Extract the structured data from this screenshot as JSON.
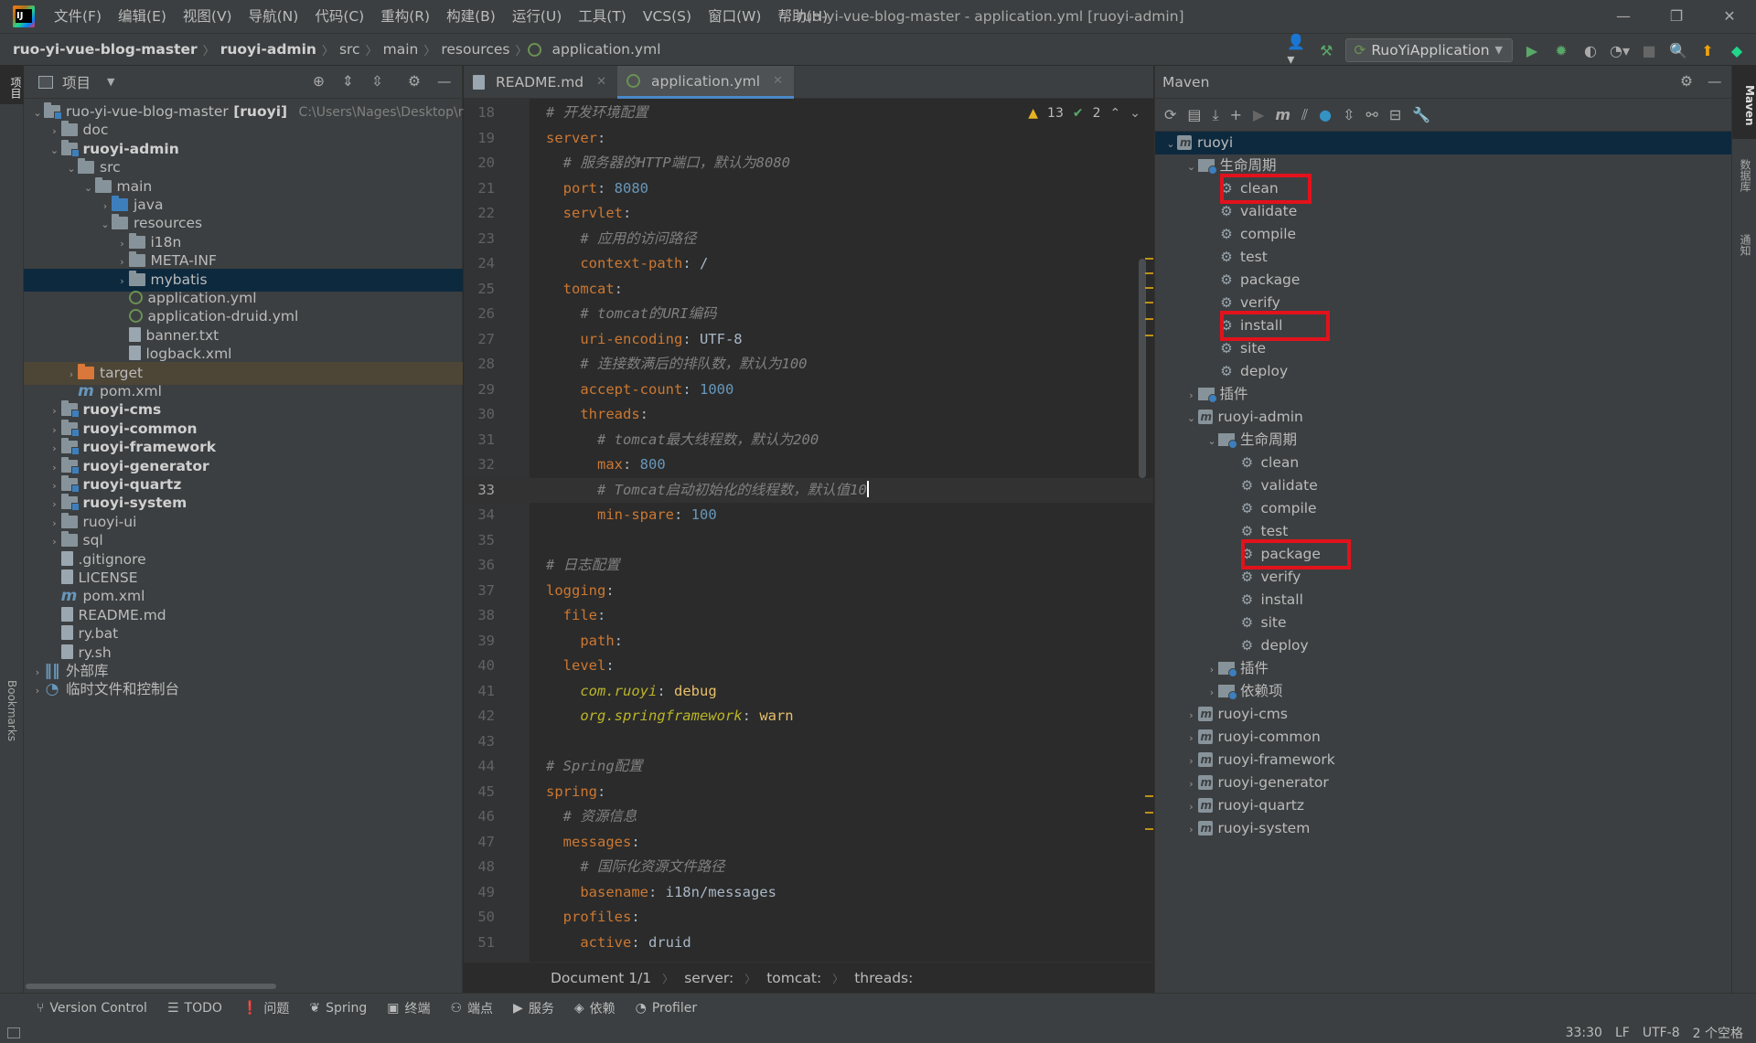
{
  "window": {
    "title": "ruo-yi-vue-blog-master - application.yml [ruoyi-admin]"
  },
  "menu": [
    "文件(F)",
    "编辑(E)",
    "视图(V)",
    "导航(N)",
    "代码(C)",
    "重构(R)",
    "构建(B)",
    "运行(U)",
    "工具(T)",
    "VCS(S)",
    "窗口(W)",
    "帮助(H)"
  ],
  "breadcrumb": [
    "ruo-yi-vue-blog-master",
    "ruoyi-admin",
    "src",
    "main",
    "resources",
    "application.yml"
  ],
  "run_config": "RuoYiApplication",
  "left_strip": {
    "project": "项目",
    "bookmarks": "Bookmarks",
    "structure": "结构"
  },
  "right_strip": {
    "maven": "Maven",
    "database": "数据库",
    "notifications": "通知"
  },
  "project": {
    "header": "项目",
    "tree": [
      {
        "label": "ruo-yi-vue-blog-master",
        "suffix": "[ruoyi]",
        "path": "C:\\Users\\Nages\\Desktop\\r",
        "icon": "module",
        "indent": 0,
        "arrow": "down"
      },
      {
        "label": "doc",
        "icon": "folder",
        "indent": 1,
        "arrow": "right"
      },
      {
        "label": "ruoyi-admin",
        "icon": "module",
        "indent": 1,
        "arrow": "down",
        "bold": true
      },
      {
        "label": "src",
        "icon": "folder",
        "indent": 2,
        "arrow": "down"
      },
      {
        "label": "main",
        "icon": "folder",
        "indent": 3,
        "arrow": "down"
      },
      {
        "label": "java",
        "icon": "folder-blue",
        "indent": 4,
        "arrow": "right"
      },
      {
        "label": "resources",
        "icon": "folder",
        "indent": 4,
        "arrow": "down"
      },
      {
        "label": "i18n",
        "icon": "folder",
        "indent": 5,
        "arrow": "right"
      },
      {
        "label": "META-INF",
        "icon": "folder",
        "indent": 5,
        "arrow": "right"
      },
      {
        "label": "mybatis",
        "icon": "folder",
        "indent": 5,
        "arrow": "right",
        "selected": true
      },
      {
        "label": "application.yml",
        "icon": "yml",
        "indent": 5,
        "arrow": ""
      },
      {
        "label": "application-druid.yml",
        "icon": "yml",
        "indent": 5,
        "arrow": ""
      },
      {
        "label": "banner.txt",
        "icon": "file",
        "indent": 5,
        "arrow": ""
      },
      {
        "label": "logback.xml",
        "icon": "file",
        "indent": 5,
        "arrow": ""
      },
      {
        "label": "target",
        "icon": "folder-orange",
        "indent": 2,
        "arrow": "right",
        "target": true
      },
      {
        "label": "pom.xml",
        "icon": "mvn",
        "indent": 2,
        "arrow": ""
      },
      {
        "label": "ruoyi-cms",
        "icon": "module",
        "indent": 1,
        "arrow": "right",
        "bold": true
      },
      {
        "label": "ruoyi-common",
        "icon": "module",
        "indent": 1,
        "arrow": "right",
        "bold": true
      },
      {
        "label": "ruoyi-framework",
        "icon": "module",
        "indent": 1,
        "arrow": "right",
        "bold": true
      },
      {
        "label": "ruoyi-generator",
        "icon": "module",
        "indent": 1,
        "arrow": "right",
        "bold": true
      },
      {
        "label": "ruoyi-quartz",
        "icon": "module",
        "indent": 1,
        "arrow": "right",
        "bold": true
      },
      {
        "label": "ruoyi-system",
        "icon": "module",
        "indent": 1,
        "arrow": "right",
        "bold": true
      },
      {
        "label": "ruoyi-ui",
        "icon": "folder",
        "indent": 1,
        "arrow": "right"
      },
      {
        "label": "sql",
        "icon": "folder",
        "indent": 1,
        "arrow": "right"
      },
      {
        "label": ".gitignore",
        "icon": "file",
        "indent": 1,
        "arrow": ""
      },
      {
        "label": "LICENSE",
        "icon": "file",
        "indent": 1,
        "arrow": ""
      },
      {
        "label": "pom.xml",
        "icon": "mvn",
        "indent": 1,
        "arrow": ""
      },
      {
        "label": "README.md",
        "icon": "file",
        "indent": 1,
        "arrow": ""
      },
      {
        "label": "ry.bat",
        "icon": "file",
        "indent": 1,
        "arrow": ""
      },
      {
        "label": "ry.sh",
        "icon": "file",
        "indent": 1,
        "arrow": ""
      },
      {
        "label": "外部库",
        "icon": "lib",
        "indent": 0,
        "arrow": "right"
      },
      {
        "label": "临时文件和控制台",
        "icon": "scratch",
        "indent": 0,
        "arrow": "right"
      }
    ]
  },
  "editor": {
    "tabs": [
      {
        "label": "README.md",
        "active": false
      },
      {
        "label": "application.yml",
        "active": true
      }
    ],
    "inspections": {
      "warnings": "13",
      "ok": "2"
    },
    "lines": [
      {
        "n": "18",
        "parts": [
          [
            "c",
            "# 开发环境配置"
          ]
        ]
      },
      {
        "n": "19",
        "parts": [
          [
            "k",
            "server"
          ],
          [
            "s",
            ":"
          ]
        ]
      },
      {
        "n": "20",
        "parts": [
          [
            "s",
            "  "
          ],
          [
            "c",
            "# 服务器的HTTP端口，默认为8080"
          ]
        ]
      },
      {
        "n": "21",
        "parts": [
          [
            "s",
            "  "
          ],
          [
            "k",
            "port"
          ],
          [
            "s",
            ": "
          ],
          [
            "v",
            "8080"
          ]
        ]
      },
      {
        "n": "22",
        "parts": [
          [
            "s",
            "  "
          ],
          [
            "k",
            "servlet"
          ],
          [
            "s",
            ":"
          ]
        ]
      },
      {
        "n": "23",
        "parts": [
          [
            "s",
            "    "
          ],
          [
            "c",
            "# 应用的访问路径"
          ]
        ]
      },
      {
        "n": "24",
        "parts": [
          [
            "s",
            "    "
          ],
          [
            "k",
            "context-path"
          ],
          [
            "s",
            ": /"
          ]
        ]
      },
      {
        "n": "25",
        "parts": [
          [
            "s",
            "  "
          ],
          [
            "k",
            "tomcat"
          ],
          [
            "s",
            ":"
          ]
        ]
      },
      {
        "n": "26",
        "parts": [
          [
            "s",
            "    "
          ],
          [
            "c",
            "# tomcat的URI编码"
          ]
        ]
      },
      {
        "n": "27",
        "parts": [
          [
            "s",
            "    "
          ],
          [
            "k",
            "uri-encoding"
          ],
          [
            "s",
            ": UTF-8"
          ]
        ]
      },
      {
        "n": "28",
        "parts": [
          [
            "s",
            "    "
          ],
          [
            "c",
            "# 连接数满后的排队数，默认为100"
          ]
        ]
      },
      {
        "n": "29",
        "parts": [
          [
            "s",
            "    "
          ],
          [
            "k",
            "accept-count"
          ],
          [
            "s",
            ": "
          ],
          [
            "v",
            "1000"
          ]
        ]
      },
      {
        "n": "30",
        "parts": [
          [
            "s",
            "    "
          ],
          [
            "k",
            "threads"
          ],
          [
            "s",
            ":"
          ]
        ]
      },
      {
        "n": "31",
        "parts": [
          [
            "s",
            "      "
          ],
          [
            "c",
            "# tomcat最大线程数，默认为200"
          ]
        ]
      },
      {
        "n": "32",
        "parts": [
          [
            "s",
            "      "
          ],
          [
            "k",
            "max"
          ],
          [
            "s",
            ": "
          ],
          [
            "v",
            "800"
          ]
        ]
      },
      {
        "n": "33",
        "parts": [
          [
            "s",
            "      "
          ],
          [
            "c",
            "# Tomcat启动初始化的线程数，默认值10"
          ]
        ],
        "current": true
      },
      {
        "n": "34",
        "parts": [
          [
            "s",
            "      "
          ],
          [
            "k",
            "min-spare"
          ],
          [
            "s",
            ": "
          ],
          [
            "v",
            "100"
          ]
        ]
      },
      {
        "n": "35",
        "parts": []
      },
      {
        "n": "36",
        "parts": [
          [
            "c",
            "# 日志配置"
          ]
        ]
      },
      {
        "n": "37",
        "parts": [
          [
            "k",
            "logging"
          ],
          [
            "s",
            ":"
          ]
        ]
      },
      {
        "n": "38",
        "parts": [
          [
            "s",
            "  "
          ],
          [
            "k",
            "file"
          ],
          [
            "s",
            ":"
          ]
        ]
      },
      {
        "n": "39",
        "parts": [
          [
            "s",
            "    "
          ],
          [
            "k",
            "path"
          ],
          [
            "s",
            ":"
          ]
        ]
      },
      {
        "n": "40",
        "parts": [
          [
            "s",
            "  "
          ],
          [
            "k",
            "level"
          ],
          [
            "s",
            ":"
          ]
        ]
      },
      {
        "n": "41",
        "parts": [
          [
            "s",
            "    "
          ],
          [
            "y",
            "com.ruoyi"
          ],
          [
            "s",
            ": "
          ],
          [
            "w",
            "debug"
          ]
        ]
      },
      {
        "n": "42",
        "parts": [
          [
            "s",
            "    "
          ],
          [
            "y",
            "org.springframework"
          ],
          [
            "s",
            ": "
          ],
          [
            "w",
            "warn"
          ]
        ]
      },
      {
        "n": "43",
        "parts": []
      },
      {
        "n": "44",
        "parts": [
          [
            "c",
            "# Spring配置"
          ]
        ]
      },
      {
        "n": "45",
        "parts": [
          [
            "k",
            "spring"
          ],
          [
            "s",
            ":"
          ]
        ]
      },
      {
        "n": "46",
        "parts": [
          [
            "s",
            "  "
          ],
          [
            "c",
            "# 资源信息"
          ]
        ]
      },
      {
        "n": "47",
        "parts": [
          [
            "s",
            "  "
          ],
          [
            "k",
            "messages"
          ],
          [
            "s",
            ":"
          ]
        ]
      },
      {
        "n": "48",
        "parts": [
          [
            "s",
            "    "
          ],
          [
            "c",
            "# 国际化资源文件路径"
          ]
        ]
      },
      {
        "n": "49",
        "parts": [
          [
            "s",
            "    "
          ],
          [
            "k",
            "basename"
          ],
          [
            "s",
            ": i18n/messages"
          ]
        ]
      },
      {
        "n": "50",
        "parts": [
          [
            "s",
            "  "
          ],
          [
            "k",
            "profiles"
          ],
          [
            "s",
            ":"
          ]
        ]
      },
      {
        "n": "51",
        "parts": [
          [
            "s",
            "    "
          ],
          [
            "k",
            "active"
          ],
          [
            "s",
            ": druid"
          ]
        ]
      }
    ],
    "breadcrumbs": [
      "Document 1/1",
      "server:",
      "tomcat:",
      "threads:"
    ]
  },
  "maven": {
    "header": "Maven",
    "tree": [
      {
        "label": "ruoyi",
        "icon": "mproj",
        "indent": 0,
        "arrow": "down",
        "selected": true
      },
      {
        "label": "生命周期",
        "icon": "lc",
        "indent": 1,
        "arrow": "down"
      },
      {
        "label": "clean",
        "icon": "gear",
        "indent": 2,
        "arrow": "",
        "highlight": true
      },
      {
        "label": "validate",
        "icon": "gear",
        "indent": 2,
        "arrow": ""
      },
      {
        "label": "compile",
        "icon": "gear",
        "indent": 2,
        "arrow": ""
      },
      {
        "label": "test",
        "icon": "gear",
        "indent": 2,
        "arrow": ""
      },
      {
        "label": "package",
        "icon": "gear",
        "indent": 2,
        "arrow": ""
      },
      {
        "label": "verify",
        "icon": "gear",
        "indent": 2,
        "arrow": ""
      },
      {
        "label": "install",
        "icon": "gear",
        "indent": 2,
        "arrow": "",
        "highlight": true
      },
      {
        "label": "site",
        "icon": "gear",
        "indent": 2,
        "arrow": ""
      },
      {
        "label": "deploy",
        "icon": "gear",
        "indent": 2,
        "arrow": ""
      },
      {
        "label": "插件",
        "icon": "lc",
        "indent": 1,
        "arrow": "right"
      },
      {
        "label": "ruoyi-admin",
        "icon": "mproj",
        "indent": 1,
        "arrow": "down"
      },
      {
        "label": "生命周期",
        "icon": "lc",
        "indent": 2,
        "arrow": "down"
      },
      {
        "label": "clean",
        "icon": "gear",
        "indent": 3,
        "arrow": ""
      },
      {
        "label": "validate",
        "icon": "gear",
        "indent": 3,
        "arrow": ""
      },
      {
        "label": "compile",
        "icon": "gear",
        "indent": 3,
        "arrow": ""
      },
      {
        "label": "test",
        "icon": "gear",
        "indent": 3,
        "arrow": ""
      },
      {
        "label": "package",
        "icon": "gear",
        "indent": 3,
        "arrow": "",
        "highlight": true
      },
      {
        "label": "verify",
        "icon": "gear",
        "indent": 3,
        "arrow": ""
      },
      {
        "label": "install",
        "icon": "gear",
        "indent": 3,
        "arrow": ""
      },
      {
        "label": "site",
        "icon": "gear",
        "indent": 3,
        "arrow": ""
      },
      {
        "label": "deploy",
        "icon": "gear",
        "indent": 3,
        "arrow": ""
      },
      {
        "label": "插件",
        "icon": "lc",
        "indent": 2,
        "arrow": "right"
      },
      {
        "label": "依赖项",
        "icon": "lc",
        "indent": 2,
        "arrow": "right"
      },
      {
        "label": "ruoyi-cms",
        "icon": "mproj",
        "indent": 1,
        "arrow": "right"
      },
      {
        "label": "ruoyi-common",
        "icon": "mproj",
        "indent": 1,
        "arrow": "right"
      },
      {
        "label": "ruoyi-framework",
        "icon": "mproj",
        "indent": 1,
        "arrow": "right"
      },
      {
        "label": "ruoyi-generator",
        "icon": "mproj",
        "indent": 1,
        "arrow": "right"
      },
      {
        "label": "ruoyi-quartz",
        "icon": "mproj",
        "indent": 1,
        "arrow": "right"
      },
      {
        "label": "ruoyi-system",
        "icon": "mproj",
        "indent": 1,
        "arrow": "right"
      }
    ]
  },
  "toolwindows": [
    {
      "label": "Version Control",
      "icon": "vcs-icon",
      "glyph": "⑂"
    },
    {
      "label": "TODO",
      "icon": "todo-icon",
      "glyph": "☰"
    },
    {
      "label": "问题",
      "icon": "problems-icon",
      "glyph": "❗"
    },
    {
      "label": "Spring",
      "icon": "spring-icon",
      "glyph": "❦"
    },
    {
      "label": "终端",
      "icon": "terminal-icon",
      "glyph": "▣"
    },
    {
      "label": "端点",
      "icon": "endpoints-icon",
      "glyph": "⚇"
    },
    {
      "label": "服务",
      "icon": "services-icon",
      "glyph": "▶"
    },
    {
      "label": "依赖",
      "icon": "dependencies-icon",
      "glyph": "◈"
    },
    {
      "label": "Profiler",
      "icon": "profiler-icon",
      "glyph": "◔"
    }
  ],
  "status": {
    "position": "33:30",
    "line_sep": "LF",
    "encoding": "UTF-8",
    "indent": "2 个空格"
  }
}
